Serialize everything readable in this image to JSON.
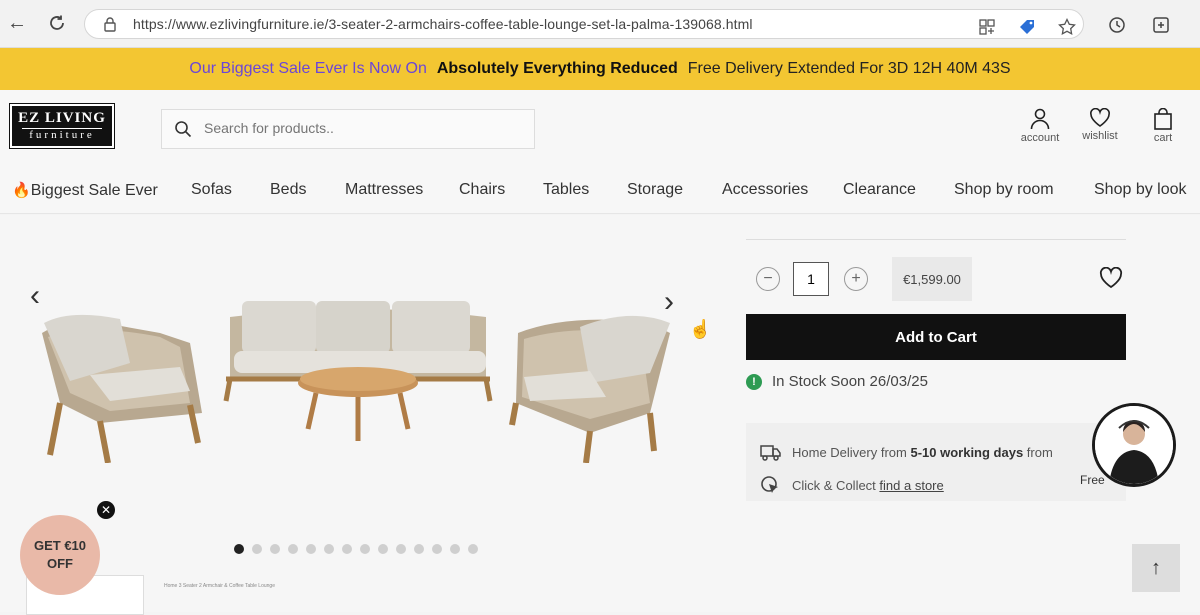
{
  "browser": {
    "url": "https://www.ezlivingfurniture.ie/3-seater-2-armchairs-coffee-table-lounge-set-la-palma-139068.html"
  },
  "promo": {
    "headline": "Our Biggest Sale Ever Is Now On",
    "emphasis": "Absolutely Everything Reduced",
    "countdown": "Free Delivery Extended For 3D 12H 40M 43S",
    "colors": {
      "bar": "#f3c632",
      "headline": "#6b46d8"
    }
  },
  "header": {
    "logo_line1": "EZ LIVING",
    "logo_line2": "furniture",
    "search_placeholder": "Search for products..",
    "account_label": "account",
    "wishlist_label": "wishlist",
    "cart_label": "cart"
  },
  "nav": {
    "items": [
      "Biggest Sale Ever",
      "Sofas",
      "Beds",
      "Mattresses",
      "Chairs",
      "Tables",
      "Storage",
      "Accessories",
      "Clearance",
      "Shop by room",
      "Shop by look"
    ]
  },
  "product": {
    "quantity": "1",
    "price": "€1,599.00",
    "add_to_cart": "Add to Cart",
    "stock_status": "In Stock Soon 26/03/25",
    "delivery_prefix": "Home Delivery from ",
    "delivery_days": "5-10 working days",
    "delivery_suffix": " from",
    "collect_prefix": "Click & Collect ",
    "collect_link": "find a store",
    "free_text": "Free",
    "thumb_caption": "Home 3 Seater 2 Armchair & Coffee Table Lounge",
    "image_count": 14,
    "active_image": 1
  },
  "promo_badge": {
    "line1": "GET €10",
    "line2": "OFF"
  },
  "icons": {
    "scroll_top": "↑"
  }
}
